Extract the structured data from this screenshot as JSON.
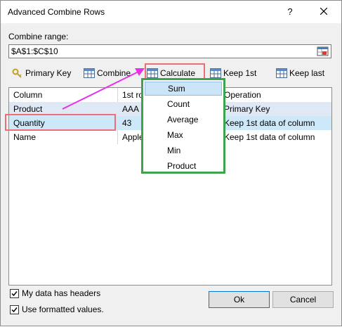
{
  "window": {
    "title": "Advanced Combine Rows",
    "help_label": "?"
  },
  "range": {
    "label": "Combine range:",
    "value": "$A$1:$C$10"
  },
  "toolbar": {
    "primary_key": "Primary Key",
    "combine": "Combine",
    "calculate": "Calculate",
    "keep_first": "Keep 1st",
    "keep_last": "Keep last"
  },
  "grid": {
    "headers": [
      "Column",
      "1st ro",
      "Operation"
    ],
    "rows": [
      {
        "column": "Product",
        "first": "AAA",
        "operation": "Primary Key"
      },
      {
        "column": "Quantity",
        "first": "43",
        "operation": "Keep 1st data of column"
      },
      {
        "column": "Name",
        "first": "Apple",
        "operation": "Keep 1st data of column"
      }
    ]
  },
  "calc_menu": {
    "items": [
      "Sum",
      "Count",
      "Average",
      "Max",
      "Min",
      "Product"
    ],
    "hovered": "Sum"
  },
  "options": {
    "has_headers": "My data has headers",
    "formatted_values": "Use formatted values."
  },
  "buttons": {
    "ok": "Ok",
    "cancel": "Cancel"
  },
  "colors": {
    "highlight_red": "#e9707a",
    "menu_border_green": "#3fa34d",
    "arrow_magenta": "#e632e6",
    "row_selected": "#cde8f8"
  }
}
